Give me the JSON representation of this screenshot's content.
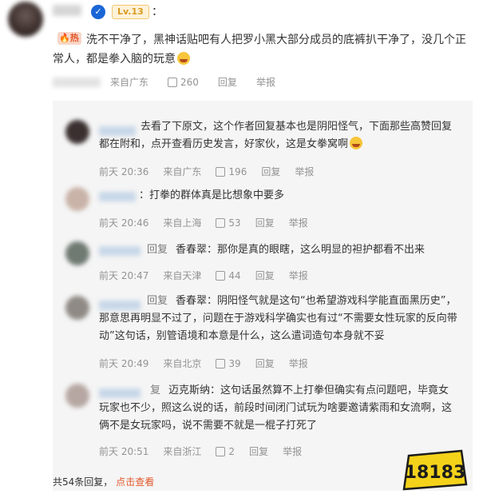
{
  "main": {
    "level": "Lv.13",
    "colon": "：",
    "hot_label": "热",
    "text": "洗不干净了，黑神话贴吧有人把罗小黑大部分成员的底裤扒干净了，没几个正常人，都是拳入脑的玩意",
    "location": "来自广东",
    "likes": "260",
    "reply": "回复",
    "report": "举报"
  },
  "replies": [
    {
      "text": "去看了下原文，这个作者回复基本也是阴阳怪气，下面那些高赞回复都在附和，点开查看历史发言，好家伙，这是女拳窝啊",
      "time": "前天 20:36",
      "location": "来自广东",
      "likes": "196",
      "reply": "回复",
      "report": "举报"
    },
    {
      "text": "：打拳的群体真是比想象中要多",
      "time": "前天 20:46",
      "location": "来自上海",
      "likes": "53",
      "reply": "回复",
      "report": "举报"
    },
    {
      "reply_label": "回复",
      "mention": "香春翠",
      "text": "：那你是真的眼瞎，这么明显的袒护都看不出来",
      "time": "前天 20:47",
      "location": "来自天津",
      "likes": "44",
      "reply": "回复",
      "report": "举报"
    },
    {
      "reply_label": "回复",
      "mention": "香春翠",
      "text": "：阴阳怪气就是这句“也希望游戏科学能直面黑历史”，那意思再明显不过了，问题在于游戏科学确实也有过“不需要女性玩家的反向带动”这句话，别管语境和本意是什么，这么遣词造句本身就不妥",
      "time": "前天 20:49",
      "location": "来自北京",
      "likes": "39",
      "reply": "回复",
      "report": "举报"
    },
    {
      "reply_label": "复",
      "mention": "迈克斯纳",
      "text": "：这句话虽然算不上打拳但确实有点问题吧，毕竟女玩家也不少，照这么说的话，前段时间闭门试玩为啥要邀请紫雨和女流啊，这俩不是女玩家吗，说不需要不就是一棍子打死了",
      "time": "前天 20:51",
      "location": "来自浙江",
      "likes": "2",
      "reply": "回复",
      "report": "举报"
    }
  ],
  "footer": {
    "count": "共54条回复，",
    "link": "点击查看"
  },
  "logo": {
    "text": "18183"
  },
  "colors": {
    "accent": "#e2572a",
    "meta": "#939393",
    "panel": "#f5f5f5"
  }
}
